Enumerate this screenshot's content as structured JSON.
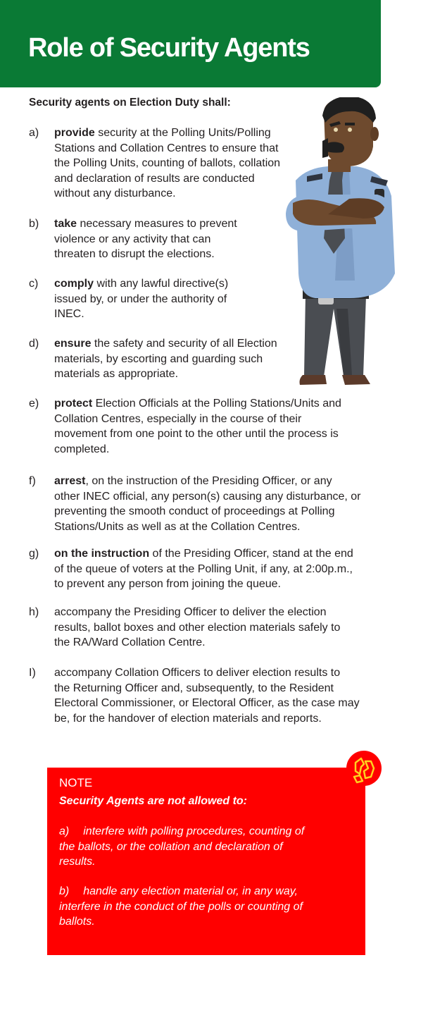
{
  "header": {
    "title": "Role of Security Agents"
  },
  "intro": "Security agents on Election Duty shall:",
  "duties": [
    {
      "letter": "a)",
      "keyword": "provide",
      "lines": [
        " security at the Polling Units/Polling",
        "Stations and Collation Centres to ensure that",
        "the Polling Units, counting of ballots, collation",
        "and declaration of results are conducted",
        "without any disturbance."
      ]
    },
    {
      "letter": "b)",
      "keyword": "take",
      "lines": [
        " necessary measures to prevent",
        "violence or any activity that can",
        "threaten to disrupt the elections."
      ]
    },
    {
      "letter": "c)",
      "keyword": "comply",
      "lines": [
        " with any lawful directive(s)",
        "issued by, or under the authority of",
        "INEC."
      ]
    },
    {
      "letter": "d)",
      "keyword": "ensure",
      "lines": [
        " the safety and security of all Election",
        "materials, by escorting and guarding such",
        "materials as appropriate."
      ]
    },
    {
      "letter": "e)",
      "keyword": "protect",
      "lines": [
        " Election Officials at the Polling Stations/Units and",
        "Collation Centres, especially in the course of their",
        "movement from one point to the other until the process is",
        "completed."
      ]
    },
    {
      "letter": "f)",
      "keyword": "arrest",
      "lines": [
        ", on the instruction of the Presiding Officer, or any",
        "other INEC official, any person(s) causing any disturbance, or",
        "preventing the smooth conduct of proceedings at Polling",
        "Stations/Units as well as at the Collation Centres."
      ]
    },
    {
      "letter": "g)",
      "keyword": "on the instruction",
      "lines": [
        " of the Presiding Officer, stand at the end",
        "of the queue of voters at the Polling Unit, if any, at 2:00p.m.,",
        "to prevent any person from joining the queue."
      ]
    },
    {
      "letter": "h)",
      "keyword": "",
      "lines": [
        "accompany the Presiding Officer to deliver the election",
        "results, ballot boxes and other election materials safely to",
        "the RA/Ward Collation Centre."
      ]
    },
    {
      "letter": "I)",
      "keyword": "",
      "lines": [
        "accompany Collation Officers to deliver election results to",
        "the Returning Officer and, subsequently, to the Resident",
        "Electoral Commissioner, or Electoral Officer, as the case may",
        "be, for the handover of election materials and reports."
      ]
    }
  ],
  "note": {
    "title": "NOTE",
    "subtitle": "Security Agents are not allowed to:",
    "items": [
      {
        "letter": "a)",
        "lines": [
          "interfere with polling procedures, counting of",
          "the ballots, or the collation and declaration of",
          "results."
        ]
      },
      {
        "letter": "b)",
        "lines": [
          "handle any election material or, in any way,",
          "interfere in the conduct of the polls or counting of",
          "ballots."
        ]
      }
    ]
  },
  "colors": {
    "header_green": "#0a7a35",
    "note_red": "#ff0000",
    "text": "#231f20"
  },
  "icons": {
    "officer_illustration": "security-officer-illustration",
    "note_icon": "hands-icon"
  }
}
